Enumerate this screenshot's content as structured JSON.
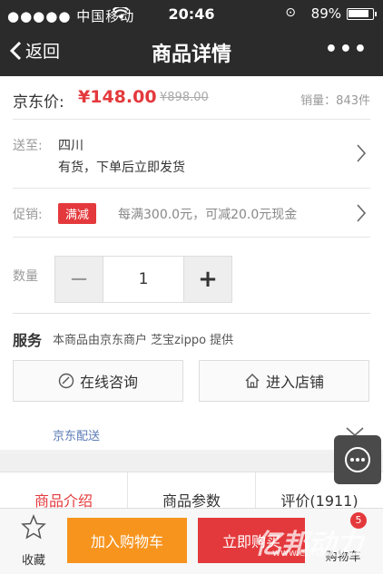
{
  "status_bar": {
    "carrier": "●●●●● 中国移动",
    "time": "20:46",
    "battery_percent": "89%"
  },
  "nav": {
    "back_label": "返回",
    "title": "商品详情",
    "more": "•••"
  },
  "price": {
    "label": "京东价:",
    "current": "¥148.00",
    "original": "¥898.00",
    "sales": "销量：843件"
  },
  "shipping": {
    "label": "送至:",
    "region": "四川",
    "stock": "有货，下单后立即发货"
  },
  "promotion": {
    "label": "促销:",
    "tag": "满减",
    "desc": "每满300.0元，可减20.0元现金"
  },
  "quantity": {
    "label": "数量",
    "minus": "−",
    "value": "1",
    "plus": "+"
  },
  "service": {
    "title": "服务",
    "desc": "本商品由京东商户 芝宝zippo 提供",
    "consult_label": "在线咨询",
    "shop_label": "进入店铺"
  },
  "delivery": {
    "label": "京东配送"
  },
  "tabs": [
    {
      "label": "商品介绍"
    },
    {
      "label": "商品参数"
    },
    {
      "label": "评价(1911)"
    }
  ],
  "bottom": {
    "favorite_label": "收藏",
    "add_cart_label": "加入购物车",
    "buy_now_label": "立即购买",
    "cart_label": "购物车",
    "cart_badge": "5"
  },
  "watermark": {
    "brand": "亿邦动力",
    "url": "www.ebrun.com"
  },
  "colors": {
    "accent_red": "#e4393c",
    "accent_orange": "#f7941e",
    "bar_dark": "#2b2b2b"
  }
}
